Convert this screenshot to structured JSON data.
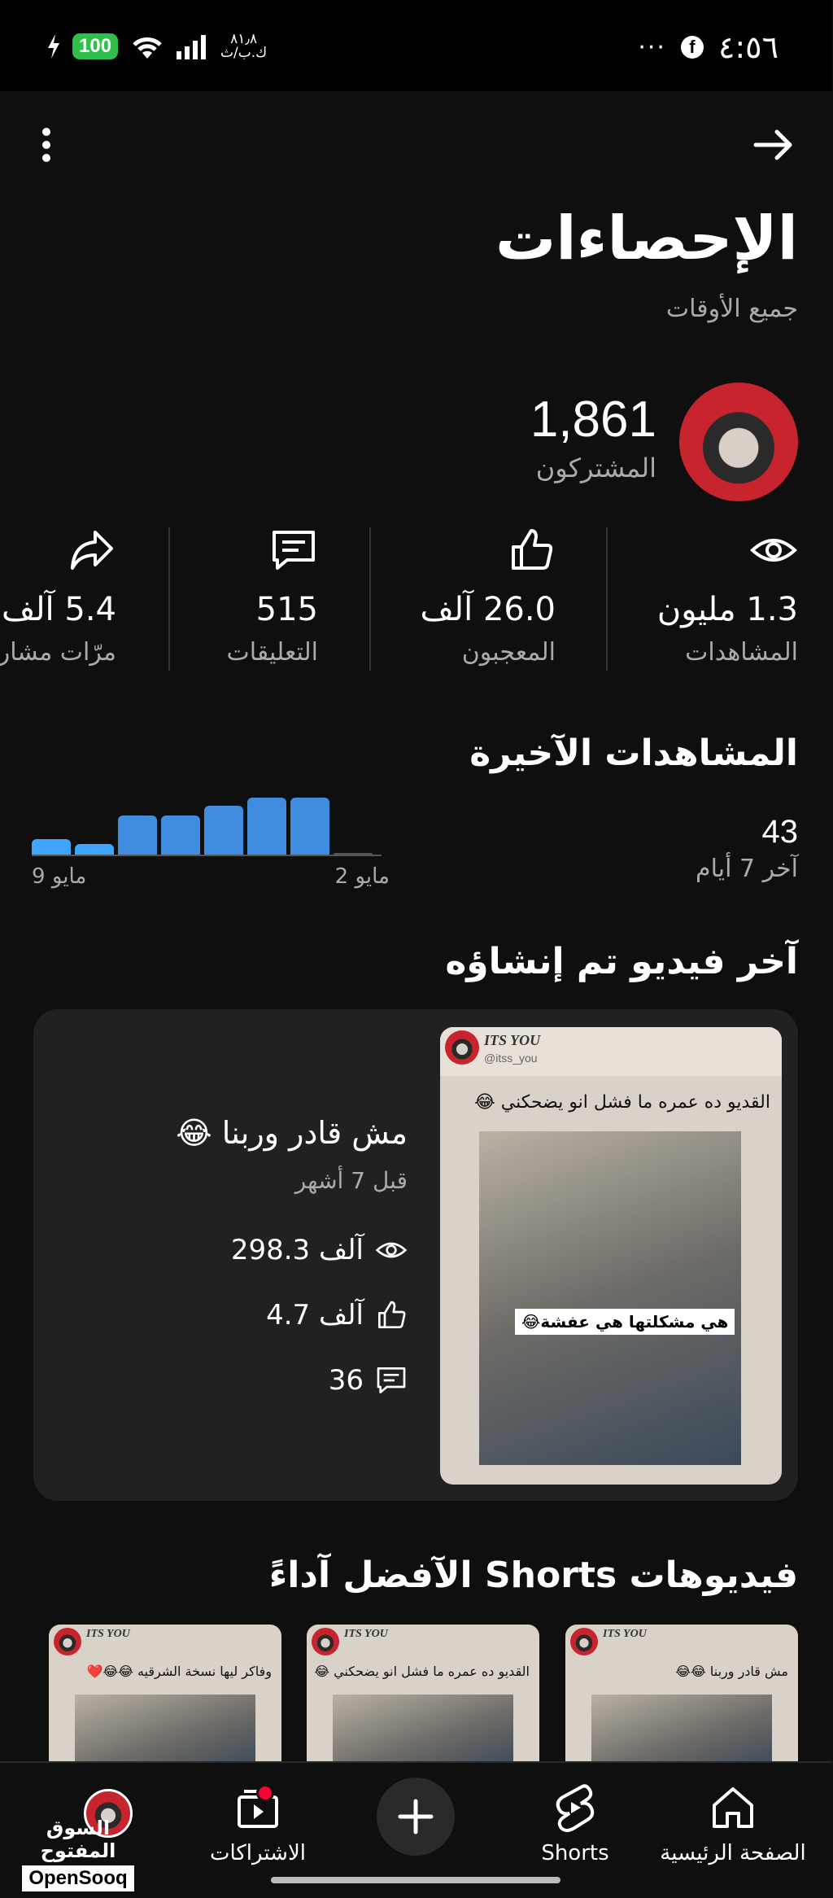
{
  "status_bar": {
    "time": "٤:٥٦",
    "battery": "100",
    "speed_value": "٨١٫٨",
    "speed_unit": "ك.ب/ث",
    "more": "···"
  },
  "header": {
    "title": "الإحصاءات",
    "subtitle": "جميع الأوقات"
  },
  "channel": {
    "subscribers": "1,861",
    "subscribers_label": "المشتركون"
  },
  "stats": [
    {
      "value": "1.3 مليون",
      "label": "المشاهدات",
      "icon": "eye-icon"
    },
    {
      "value": "26.0 آلف",
      "label": "المعجبون",
      "icon": "thumbs-up-icon"
    },
    {
      "value": "515",
      "label": "التعليقات",
      "icon": "comment-icon"
    },
    {
      "value": "5.4 آلف",
      "label": "مرّات مشاركة",
      "icon": "share-icon"
    }
  ],
  "recent_views": {
    "title": "المشاهدات الآخيرة",
    "count": "43",
    "period": "آخر 7 أيام",
    "chart_data": {
      "type": "bar",
      "categories": [
        "9 مايو",
        "",
        "",
        "",
        "",
        "",
        "",
        "2 مايو"
      ],
      "values": [
        12,
        8,
        30,
        30,
        38,
        44,
        44,
        1
      ],
      "xlabel": "",
      "ylabel": "",
      "colors": [
        "#3ea6ff",
        "#3ea6ff",
        "#3f8ce0",
        "#3f8ce0",
        "#3f8ce0",
        "#3f8ce0",
        "#3f8ce0",
        "#555555"
      ]
    }
  },
  "latest_video": {
    "section_title": "آخر فيديو تم إنشاؤه",
    "title": "مش قادر وربنا 😂",
    "age": "قبل 7 أشهر",
    "views": "298.3 آلف",
    "likes": "4.7 آلف",
    "comments": "36",
    "thumb_brand": "ITS YOU",
    "thumb_handle": "@itss_you",
    "thumb_caption": "القديو ده عمره ما فشل انو يضحكني 😂",
    "thumb_sticker": "هي مشكلتها هي عفشة😂"
  },
  "top_shorts": {
    "section_title": "فيديوهات Shorts الآفضل آداءً",
    "items": [
      {
        "brand": "ITS YOU",
        "caption": "مش قادر وربنا 😂😂"
      },
      {
        "brand": "ITS YOU",
        "caption": "القديو ده عمره ما فشل انو يضحكني 😂"
      },
      {
        "brand": "ITS YOU",
        "caption": "وفاكر ليها نسخة الشرقيه 😂😂❤️"
      }
    ]
  },
  "bottom_nav": {
    "home": "الصفحة الرئيسية",
    "shorts": "Shorts",
    "subscriptions": "الاشتراكات"
  },
  "watermark": {
    "arabic": "السوق المفتوح",
    "latin": "OpenSooq"
  }
}
